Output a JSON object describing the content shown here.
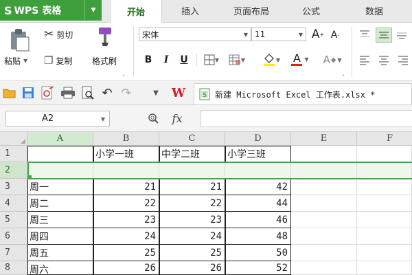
{
  "app": {
    "logo": "S",
    "name": "WPS 表格",
    "caret": "▼"
  },
  "tabs": [
    {
      "label": "开始",
      "active": true
    },
    {
      "label": "插入"
    },
    {
      "label": "页面布局"
    },
    {
      "label": "公式"
    },
    {
      "label": "数据"
    }
  ],
  "ribbon": {
    "paste_label": "粘贴",
    "cut_label": "剪切",
    "copy_label": "复制",
    "format_painter_label": "格式刷",
    "font_name": "宋体",
    "font_size": "11",
    "grow_font": "A",
    "shrink_font": "A",
    "bold": "B",
    "italic": "I",
    "underline": "U",
    "font_color_letter": "A",
    "clear_letter": "A",
    "colors": {
      "font_color": "#e0201c",
      "fill_color": "#ffee00"
    }
  },
  "quickbar": {
    "doc_title": "新建 Microsoft Excel 工作表.xlsx *",
    "wps_logo": "W"
  },
  "formula_bar": {
    "name_box": "A2",
    "fx_label": "fx",
    "formula_value": ""
  },
  "sheet": {
    "columns": [
      "A",
      "B",
      "C",
      "D",
      "E",
      "F"
    ],
    "rows": [
      {
        "num": "1",
        "cells": [
          "",
          "小学一班",
          "中学二班",
          "小学三班",
          "",
          ""
        ]
      },
      {
        "num": "2",
        "cells": [
          "",
          "",
          "",
          "",
          "",
          ""
        ]
      },
      {
        "num": "3",
        "cells": [
          "周一",
          "21",
          "21",
          "42",
          "",
          ""
        ]
      },
      {
        "num": "4",
        "cells": [
          "周二",
          "22",
          "22",
          "44",
          "",
          ""
        ]
      },
      {
        "num": "5",
        "cells": [
          "周三",
          "23",
          "23",
          "46",
          "",
          ""
        ]
      },
      {
        "num": "6",
        "cells": [
          "周四",
          "24",
          "24",
          "48",
          "",
          ""
        ]
      },
      {
        "num": "7",
        "cells": [
          "周五",
          "25",
          "25",
          "50",
          "",
          ""
        ]
      },
      {
        "num": "8",
        "cells": [
          "周六",
          "26",
          "26",
          "52",
          "",
          ""
        ]
      }
    ]
  },
  "colors": {
    "accent": "#3f9f3d",
    "selection": "#4aa34a"
  }
}
